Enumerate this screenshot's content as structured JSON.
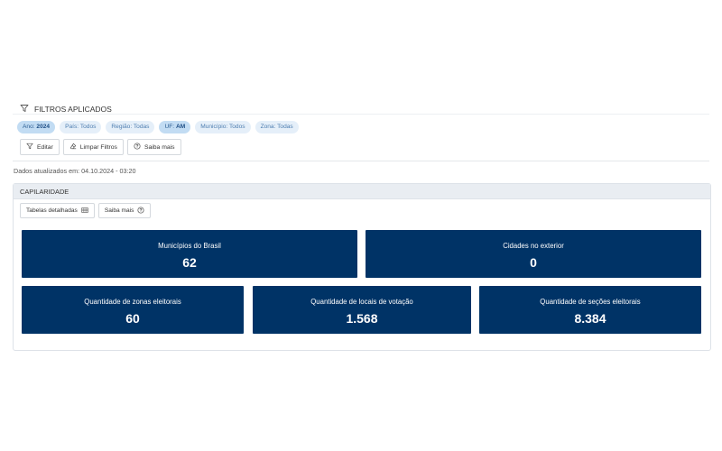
{
  "filters": {
    "title": "FILTROS APLICADOS",
    "chips": [
      {
        "label": "Ano: ",
        "value": "2024",
        "active": true
      },
      {
        "label": "País: Todos",
        "value": "",
        "active": false
      },
      {
        "label": "Região: Todas",
        "value": "",
        "active": false
      },
      {
        "label": "UF: ",
        "value": "AM",
        "active": true
      },
      {
        "label": "Município: Todos",
        "value": "",
        "active": false
      },
      {
        "label": "Zona: Todas",
        "value": "",
        "active": false
      }
    ],
    "actions": {
      "edit": "Editar",
      "clear": "Limpar Filtros",
      "help": "Saiba mais"
    }
  },
  "updated_text": "Dados atualizados em: 04.10.2024 - 03:20",
  "capilaridade": {
    "title": "CAPILARIDADE",
    "actions": {
      "tables": "Tabelas detalhadas",
      "help": "Saiba mais"
    },
    "tiles": [
      {
        "label": "Municípios do Brasil",
        "value": "62"
      },
      {
        "label": "Cidades no exterior",
        "value": "0"
      },
      {
        "label": "Quantidade de zonas eleitorais",
        "value": "60"
      },
      {
        "label": "Quantidade de locais de votação",
        "value": "1.568"
      },
      {
        "label": "Quantidade de seções eleitorais",
        "value": "8.384"
      }
    ]
  },
  "colors": {
    "tile_bg": "#003366",
    "chip_bg": "#e5eff9",
    "chip_active_bg": "#c2dcf3"
  }
}
